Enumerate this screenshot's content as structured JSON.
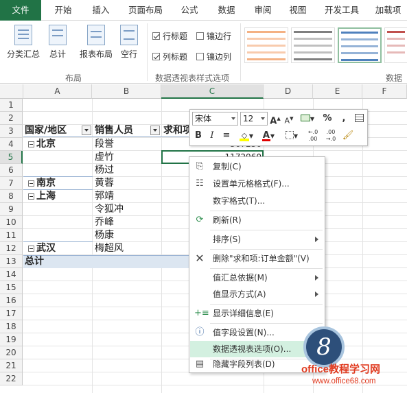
{
  "tabs": [
    "文件",
    "开始",
    "插入",
    "页面布局",
    "公式",
    "数据",
    "审阅",
    "视图",
    "开发工具",
    "加载项"
  ],
  "ribbon": {
    "layout_buttons": [
      "分类汇总",
      "总计",
      "报表布局",
      "空行"
    ],
    "layout_group_label": "布局",
    "options": {
      "row_headers": "行标题",
      "banded_rows": "镶边行",
      "col_headers": "列标题",
      "banded_cols": "镶边列"
    },
    "options_group_label": "数据透视表样式选项",
    "styles_group_label": "数据透"
  },
  "columns": [
    "A",
    "B",
    "C",
    "D",
    "E",
    "F"
  ],
  "rows": [
    "1",
    "2",
    "3",
    "4",
    "5",
    "6",
    "7",
    "8",
    "9",
    "10",
    "11",
    "12",
    "13",
    "14",
    "15",
    "16",
    "17",
    "18",
    "19",
    "20",
    "21",
    "22"
  ],
  "pivot": {
    "header_a": "国家/地区",
    "header_b": "销售人员",
    "header_c": "求和项",
    "cells": [
      {
        "region": "北京",
        "person": "段誉",
        "value": "367256"
      },
      {
        "region": "",
        "person": "虚竹",
        "value": "1172960"
      },
      {
        "region": "",
        "person": "杨过",
        "value": ""
      },
      {
        "region": "南京",
        "person": "黄蓉",
        "value": ""
      },
      {
        "region": "上海",
        "person": "郭靖",
        "value": ""
      },
      {
        "region": "",
        "person": "令狐冲",
        "value": ""
      },
      {
        "region": "",
        "person": "乔峰",
        "value": ""
      },
      {
        "region": "",
        "person": "杨康",
        "value": ""
      },
      {
        "region": "武汉",
        "person": "梅超风",
        "value": ""
      }
    ],
    "total_label": "总计"
  },
  "mini_toolbar": {
    "font": "宋体",
    "size": "12",
    "percent": "%",
    "comma": ","
  },
  "context_menu": [
    {
      "label": "复制(C)",
      "icon": "copy-icon"
    },
    {
      "label": "设置单元格格式(F)...",
      "icon": "format-cells-icon"
    },
    {
      "label": "数字格式(T)...",
      "icon": ""
    },
    {
      "label": "刷新(R)",
      "icon": "refresh-icon"
    },
    {
      "label": "排序(S)",
      "icon": "",
      "submenu": true
    },
    {
      "label": "删除\"求和项:订单金额\"(V)",
      "icon": "delete-x-icon"
    },
    {
      "label": "值汇总依据(M)",
      "icon": "",
      "submenu": true
    },
    {
      "label": "值显示方式(A)",
      "icon": "",
      "submenu": true
    },
    {
      "label": "显示详细信息(E)",
      "icon": "show-details-icon"
    },
    {
      "label": "值字段设置(N)...",
      "icon": "field-settings-icon"
    },
    {
      "label": "数据透视表选项(O)...",
      "icon": ""
    },
    {
      "label": "隐藏字段列表(D)",
      "icon": "field-list-icon"
    }
  ],
  "badge": "8",
  "watermark": {
    "line1": "office教程学习网",
    "line2": "www.office68.com"
  }
}
